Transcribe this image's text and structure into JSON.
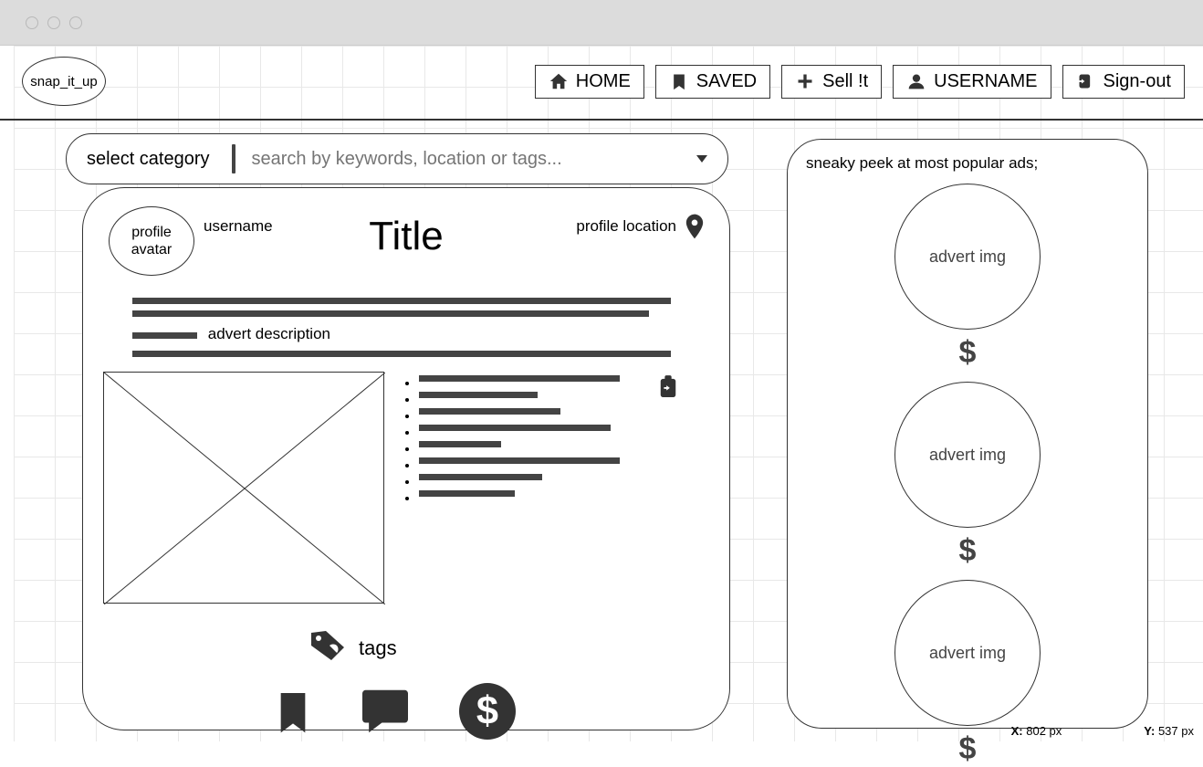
{
  "logo": "snap_it_up",
  "nav": {
    "home": "HOME",
    "saved": "SAVED",
    "sell": "Sell !t",
    "username": "USERNAME",
    "signout": "Sign-out"
  },
  "search": {
    "select_category": "select category",
    "placeholder": "search by keywords, location or tags..."
  },
  "card": {
    "avatar_line1": "profile",
    "avatar_line2": "avatar",
    "username": "username",
    "title": "Title",
    "location": "profile location",
    "description_label": "advert description",
    "tags": "tags"
  },
  "sidebar": {
    "title": "sneaky peek at most popular ads;",
    "items": [
      {
        "label": "advert img",
        "price": "$"
      },
      {
        "label": "advert img",
        "price": "$"
      },
      {
        "label": "advert img",
        "price": "$"
      }
    ]
  },
  "status": {
    "x_label": "X:",
    "x_value": "802 px",
    "y_label": "Y:",
    "y_value": "537 px"
  }
}
